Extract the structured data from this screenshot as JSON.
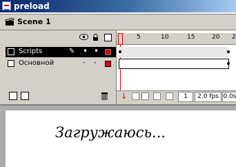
{
  "window": {
    "title": "preload"
  },
  "scene": {
    "label": "Scene 1"
  },
  "layers": [
    {
      "name": "Scripts",
      "selected": true,
      "color": "#e00000"
    },
    {
      "name": "Основной",
      "selected": false,
      "color": "#e00000"
    }
  ],
  "ruler": {
    "ticks": [
      "5",
      "10",
      "15",
      "20",
      "2"
    ]
  },
  "status": {
    "current_frame": "1",
    "fps": "2.0 fps",
    "elapsed": "0.0s"
  },
  "stage": {
    "text": "Загружаюсь..."
  },
  "colors": {
    "titlebar": "#0a246a",
    "playhead": "#e00000",
    "layer_swatch": "#e00000"
  }
}
